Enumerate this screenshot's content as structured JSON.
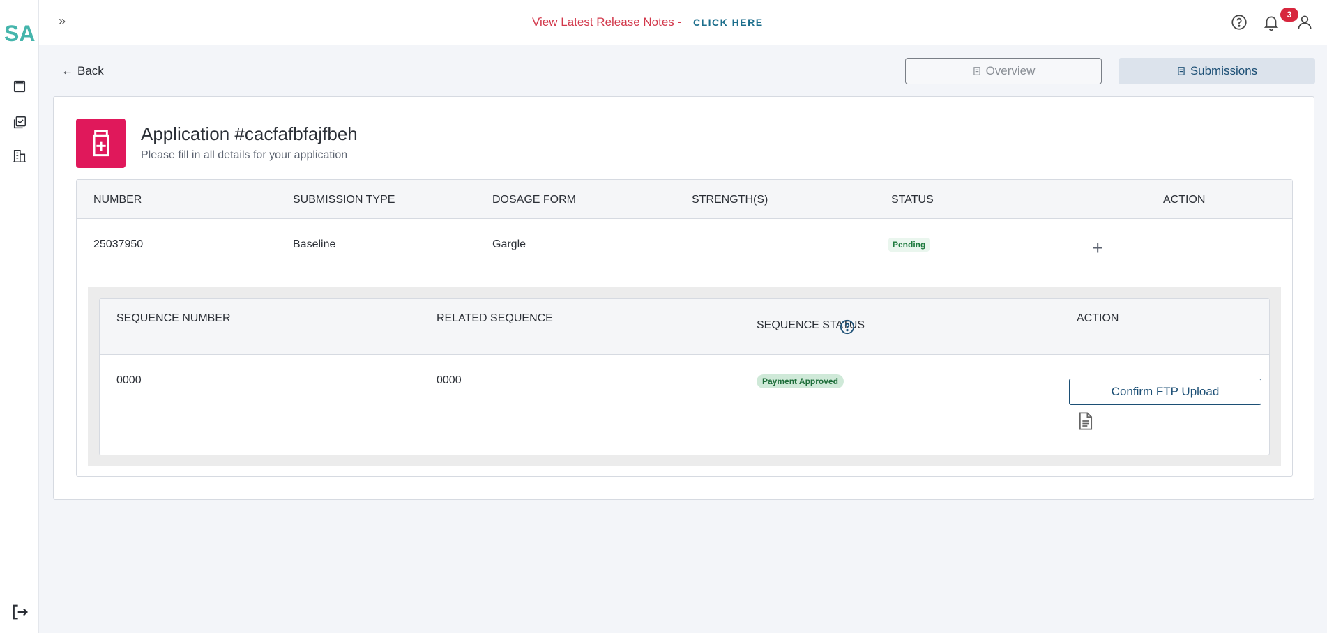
{
  "sidebar": {
    "logo": "SA",
    "items": [
      {
        "icon": "book-icon"
      },
      {
        "icon": "checklist-icon"
      },
      {
        "icon": "building-icon"
      }
    ],
    "logout_icon": "logout-icon"
  },
  "topbar": {
    "expand": "»",
    "release_text": "View Latest Release Notes -",
    "click_here": "CLICK HERE",
    "notification_count": "3"
  },
  "nav": {
    "back": "Back",
    "overview": "Overview",
    "submissions": "Submissions"
  },
  "application": {
    "title": "Application #cacfafbfajfbeh",
    "subtitle": "Please fill in all details for your application"
  },
  "submissions_table": {
    "headers": [
      "NUMBER",
      "SUBMISSION TYPE",
      "DOSAGE FORM",
      "STRENGTH(S)",
      "STATUS",
      "ACTION"
    ],
    "rows": [
      {
        "number": "25037950",
        "submission_type": "Baseline",
        "dosage_form": "Gargle",
        "strengths": "",
        "status": "Pending",
        "action": "+"
      }
    ]
  },
  "sequence_table": {
    "headers": [
      "SEQUENCE NUMBER",
      "RELATED SEQUENCE",
      "SEQUENCE STATUS",
      "ACTION"
    ],
    "help": "?",
    "rows": [
      {
        "sequence_number": "0000",
        "related_sequence": "0000",
        "status": "Payment Approved",
        "action_label": "Confirm FTP Upload"
      }
    ]
  },
  "colors": {
    "brand": "#45b5ac",
    "accent": "#e0185b",
    "release_red": "#d2384b",
    "link_blue": "#1c6e8c",
    "primary_dark": "#1c4f75"
  }
}
